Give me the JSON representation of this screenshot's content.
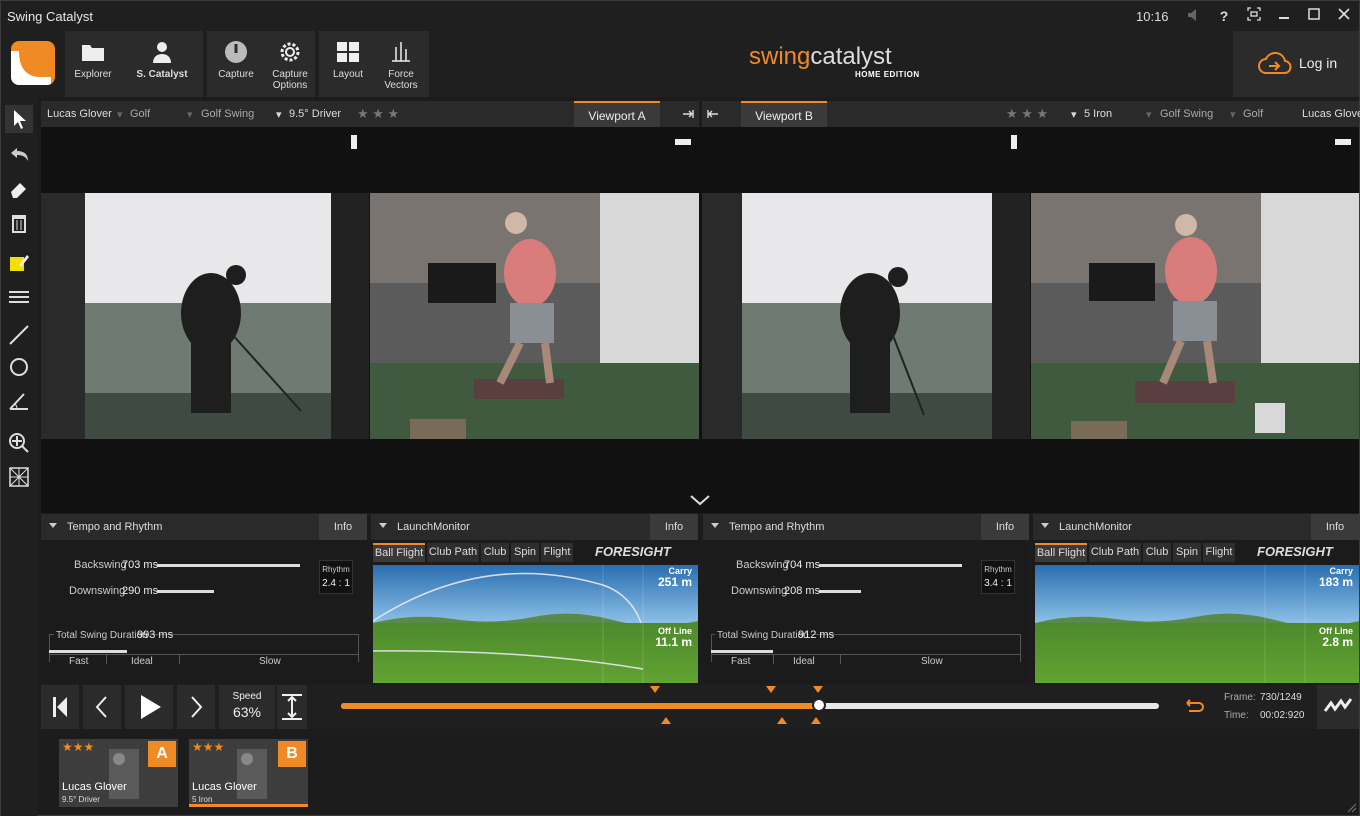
{
  "app": {
    "title": "Swing Catalyst",
    "clock": "10:16"
  },
  "toolbar": {
    "explorer": "Explorer",
    "user": "S. Catalyst",
    "capture": "Capture",
    "capture_options": [
      "Capture",
      "Options"
    ],
    "layout": "Layout",
    "force_vectors": [
      "Force",
      "Vectors"
    ],
    "login": "Log in"
  },
  "brand": {
    "swing": "swing",
    "catalyst": "catalyst",
    "edition": "HOME EDITION"
  },
  "viewport_a": {
    "player": "Lucas Glover",
    "sport": "Golf",
    "category": "Golf Swing",
    "club": "9.5° Driver",
    "tab": "Viewport A"
  },
  "viewport_b": {
    "player": "Lucas Glover",
    "sport": "Golf",
    "category": "Golf Swing",
    "club": "5 Iron",
    "tab": "Viewport B"
  },
  "panel_a": {
    "tempo_title": "Tempo and Rhythm",
    "info": "Info",
    "backswing_label": "Backswing",
    "backswing": "703 ms",
    "downswing_label": "Downswing",
    "downswing": "290 ms",
    "rhythm_label": "Rhythm",
    "rhythm": "2.4 : 1",
    "duration_label": "Total Swing Duration",
    "duration": "993 ms",
    "fast": "Fast",
    "ideal": "Ideal",
    "slow": "Slow",
    "backswing_fraction": 0.98,
    "downswing_fraction": 0.39,
    "duration_fraction": 0.25
  },
  "lm_a": {
    "title": "LaunchMonitor",
    "info": "Info",
    "tabs": [
      "Ball Flight",
      "Club Path",
      "Club",
      "Spin",
      "Flight"
    ],
    "brand": "FORESIGHT",
    "carry_label": "Carry",
    "carry": "251 m",
    "offline_label": "Off Line",
    "offline": "11.1 m"
  },
  "panel_b": {
    "tempo_title": "Tempo and Rhythm",
    "info": "Info",
    "backswing_label": "Backswing",
    "backswing": "704 ms",
    "downswing_label": "Downswing",
    "downswing": "208 ms",
    "rhythm_label": "Rhythm",
    "rhythm": "3.4 : 1",
    "duration_label": "Total Swing Duration",
    "duration": "912 ms",
    "fast": "Fast",
    "ideal": "Ideal",
    "slow": "Slow",
    "backswing_fraction": 0.98,
    "downswing_fraction": 0.29,
    "duration_fraction": 0.2
  },
  "lm_b": {
    "title": "LaunchMonitor",
    "info": "Info",
    "tabs": [
      "Ball Flight",
      "Club Path",
      "Club",
      "Spin",
      "Flight"
    ],
    "brand": "FORESIGHT",
    "carry_label": "Carry",
    "carry": "183 m",
    "offline_label": "Off Line",
    "offline": "2.8 m"
  },
  "playback": {
    "speed_label": "Speed",
    "speed": "63%",
    "frame_label": "Frame:",
    "frame": "730/1249",
    "time_label": "Time:",
    "time": "00:02:920",
    "progress_fraction": 0.584
  },
  "thumbs": [
    {
      "badge": "A",
      "name": "Lucas Glover",
      "club": "9.5° Driver",
      "stars": "★★★"
    },
    {
      "badge": "B",
      "name": "Lucas Glover",
      "club": "5 Iron",
      "stars": "★★★"
    }
  ],
  "colors": {
    "accent": "#f08a24",
    "background": "#1c1c1c",
    "panel": "#2b2b2b",
    "sky": "#5a9ad0",
    "grass": "#5c9a2e"
  },
  "icons": [
    "explorer-folder-icon",
    "user-icon",
    "capture-icon",
    "gear-icon",
    "layout-icon",
    "force-vectors-icon",
    "cloud-login-icon"
  ]
}
